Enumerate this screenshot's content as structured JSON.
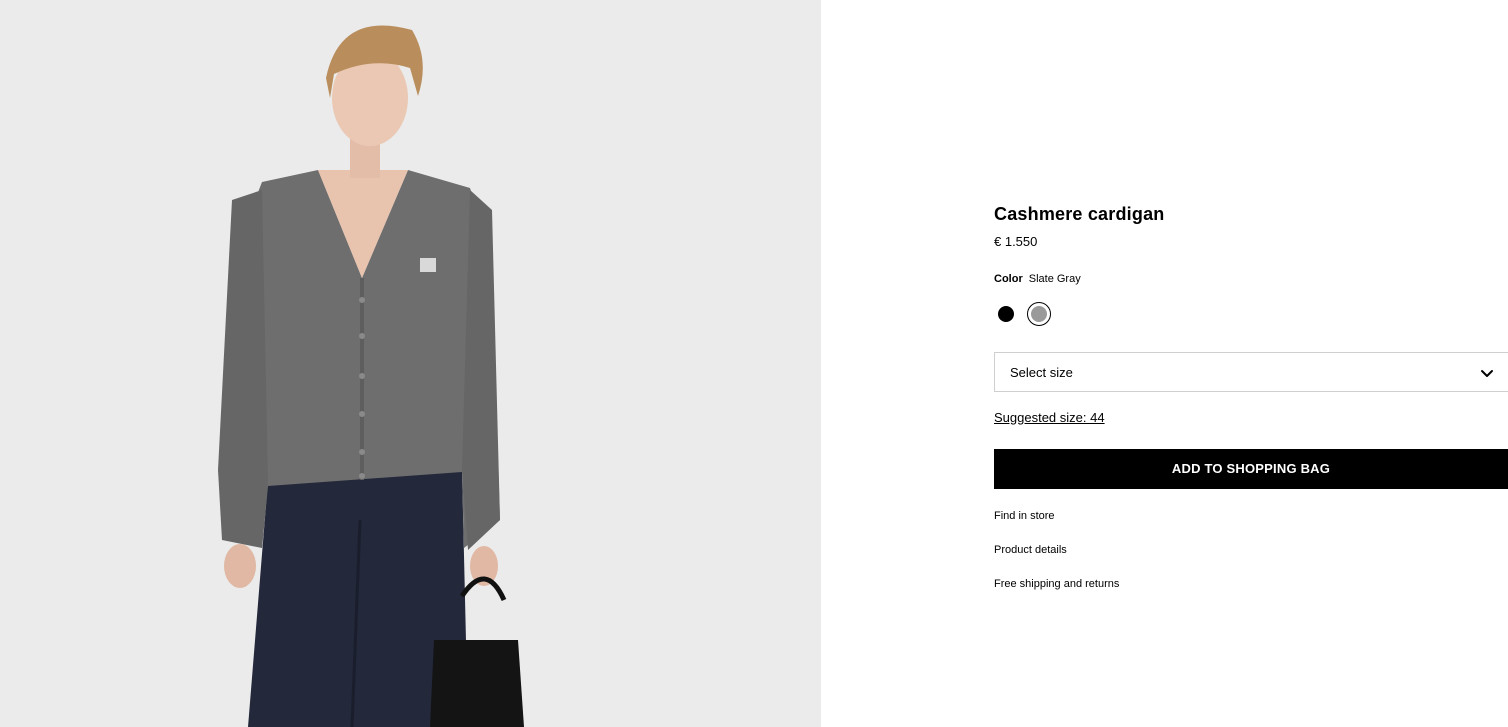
{
  "image": {
    "alt_icon": "product-photo-cardigan-model"
  },
  "product": {
    "title": "Cashmere cardigan",
    "price": "€ 1.550"
  },
  "color": {
    "label": "Color",
    "selected_value": "Slate Gray",
    "swatches": [
      {
        "name": "black",
        "hex": "#000000",
        "selected": false
      },
      {
        "name": "slate-gray",
        "hex": "#9a9a9a",
        "selected": true
      }
    ]
  },
  "size": {
    "placeholder": "Select size",
    "chevron_icon": "chevron-down-icon",
    "suggested": "Suggested size: 44"
  },
  "actions": {
    "add_to_bag": "ADD TO SHOPPING BAG"
  },
  "links": {
    "find_in_store": "Find in store",
    "product_details": "Product details",
    "shipping": "Free shipping and returns"
  },
  "colors": {
    "image_background": "#ebebeb",
    "button_background": "#000000",
    "button_text": "#ffffff"
  }
}
